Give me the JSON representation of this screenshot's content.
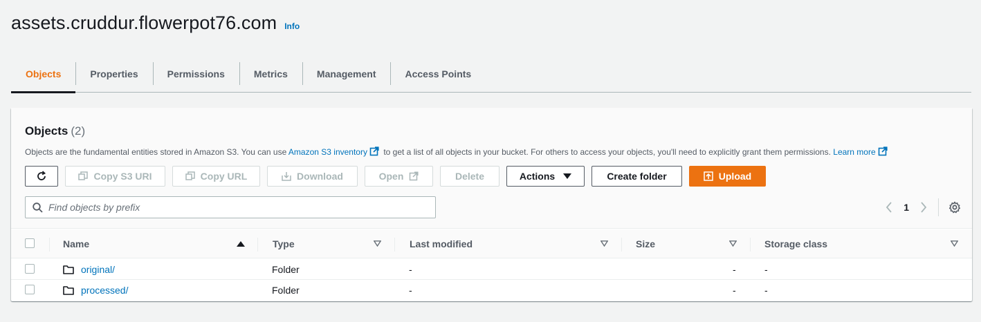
{
  "header": {
    "bucket_name": "assets.cruddur.flowerpot76.com",
    "info_label": "Info"
  },
  "tabs": [
    {
      "label": "Objects",
      "active": true
    },
    {
      "label": "Properties"
    },
    {
      "label": "Permissions"
    },
    {
      "label": "Metrics"
    },
    {
      "label": "Management"
    },
    {
      "label": "Access Points"
    }
  ],
  "objects_panel": {
    "title": "Objects",
    "count": "(2)",
    "description_start": "Objects are the fundamental entities stored in Amazon S3. You can use",
    "inventory_link": "Amazon S3 inventory",
    "description_middle": "to get a list of all objects in your bucket. For others to access your objects, you'll need to explicitly grant them permissions.",
    "learn_more": "Learn more"
  },
  "toolbar": {
    "refresh_icon": "refresh-icon",
    "copy_s3_uri": "Copy S3 URI",
    "copy_url": "Copy URL",
    "download": "Download",
    "open": "Open",
    "delete": "Delete",
    "actions": "Actions",
    "create_folder": "Create folder",
    "upload": "Upload"
  },
  "search": {
    "placeholder": "Find objects by prefix",
    "value": ""
  },
  "pagination": {
    "current_page": "1"
  },
  "table": {
    "columns": [
      "Name",
      "Type",
      "Last modified",
      "Size",
      "Storage class"
    ],
    "rows": [
      {
        "name": "original/",
        "type": "Folder",
        "last_modified": "-",
        "size": "-",
        "storage_class": "-"
      },
      {
        "name": "processed/",
        "type": "Folder",
        "last_modified": "-",
        "size": "-",
        "storage_class": "-"
      }
    ]
  },
  "colors": {
    "accent": "#ec7211",
    "link": "#0073bb",
    "text": "#16191f",
    "background": "#f2f3f3"
  }
}
